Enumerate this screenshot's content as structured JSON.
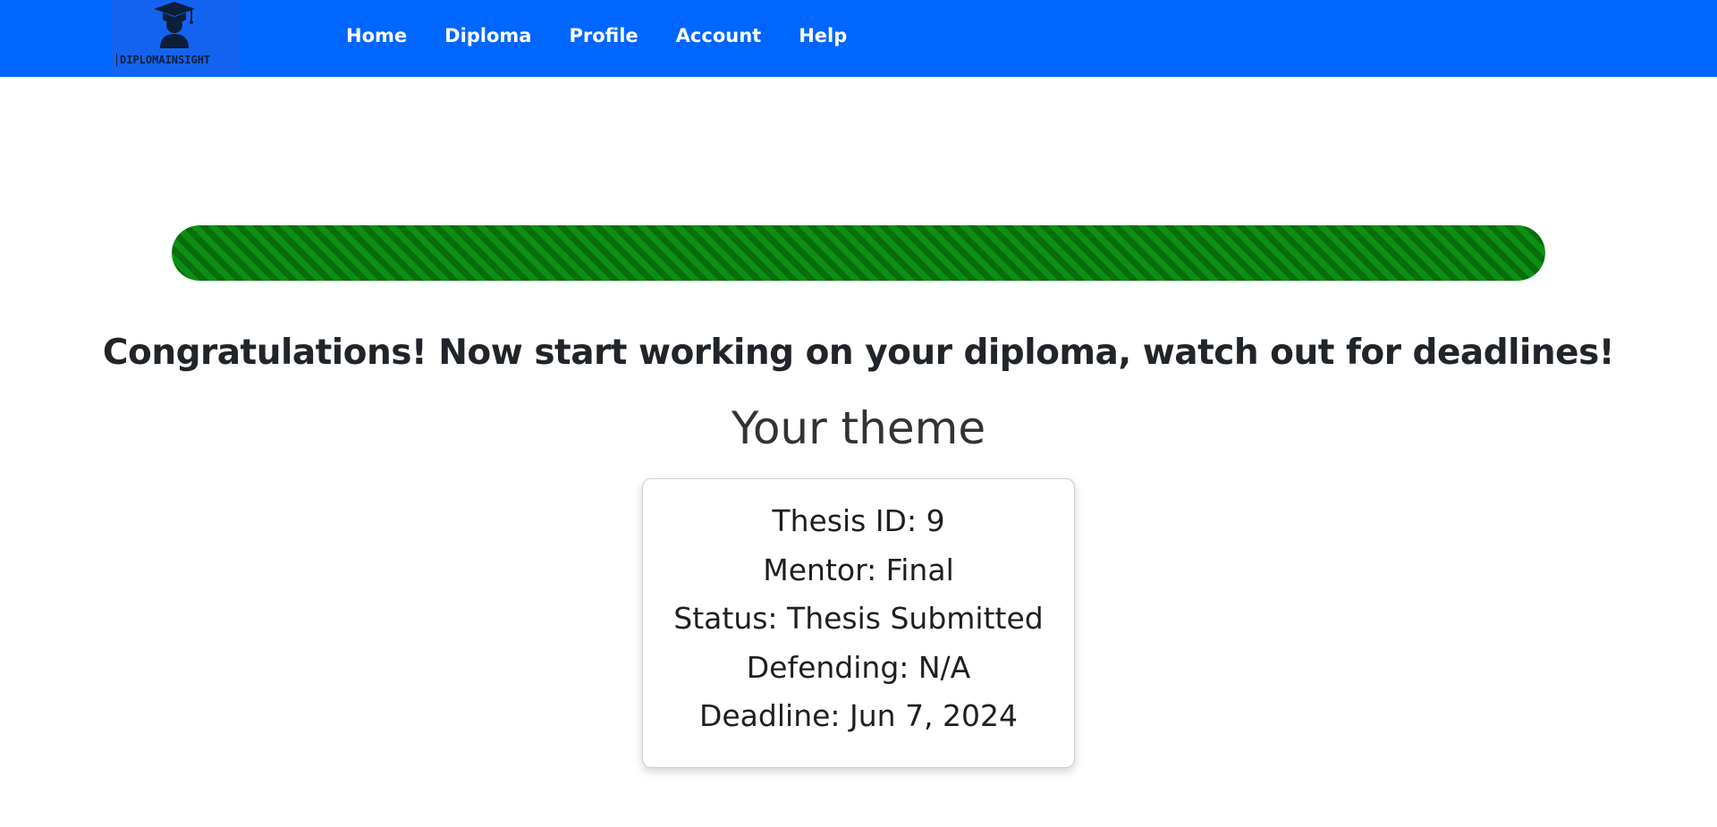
{
  "brand": {
    "name": "DIPLOMAINSIGHT",
    "icon": "graduate-cap-icon"
  },
  "nav": {
    "links": [
      {
        "label": "Home"
      },
      {
        "label": "Diploma"
      },
      {
        "label": "Profile"
      },
      {
        "label": "Account"
      },
      {
        "label": "Help"
      }
    ]
  },
  "progress": {
    "value_percent": 100,
    "color": "#0c8f14"
  },
  "main": {
    "headline": "Congratulations! Now start working on your diploma, watch out for deadlines!",
    "subheadline": "Your theme"
  },
  "thesis": {
    "id_label": "Thesis ID: 9",
    "mentor_label": "Mentor: Final",
    "status_label": "Status: Thesis Submitted",
    "defending_label": "Defending: N/A",
    "deadline_label": "Deadline: Jun 7, 2024"
  },
  "colors": {
    "navbar": "#0066ff",
    "brand_bg": "#1463f0",
    "text": "#212529"
  }
}
